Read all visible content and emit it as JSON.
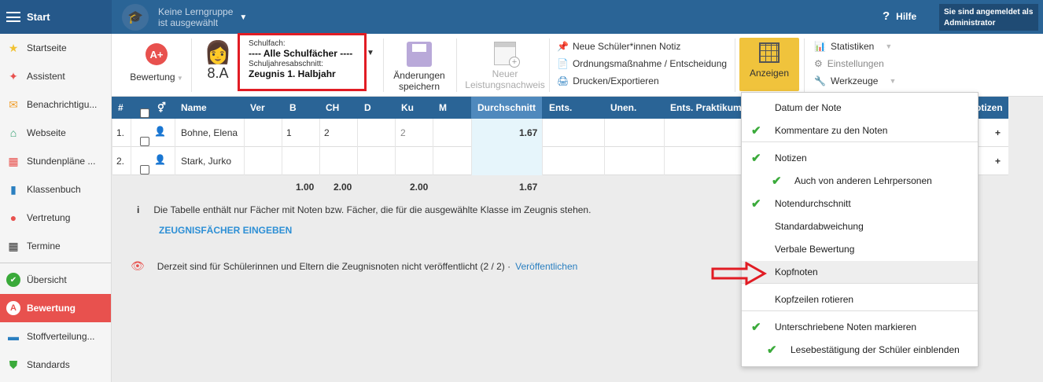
{
  "topbar": {
    "start_label": "Start",
    "group_line1": "Keine Lerngruppe",
    "group_line2": "ist ausgewählt",
    "help_label": "Hilfe",
    "login_line1": "Sie sind angemeldet als",
    "login_line2": "Administrator"
  },
  "sidebar": {
    "items": [
      {
        "label": "Startseite",
        "icon": "star-icon",
        "color": "#f1c232"
      },
      {
        "label": "Assistent",
        "icon": "wand-icon",
        "color": "#e8514e"
      },
      {
        "label": "Benachrichtigu...",
        "icon": "envelope-icon",
        "color": "#f0a030"
      },
      {
        "label": "Webseite",
        "icon": "home-icon",
        "color": "#2e9e6e"
      },
      {
        "label": "Stundenpläne ...",
        "icon": "calendar-icon",
        "color": "#e8514e"
      },
      {
        "label": "Klassenbuch",
        "icon": "book-icon",
        "color": "#2a7fc0"
      },
      {
        "label": "Vertretung",
        "icon": "person-icon",
        "color": "#e8514e"
      },
      {
        "label": "Termine",
        "icon": "calendar-icon",
        "color": "#333333"
      },
      {
        "label": "Übersicht",
        "icon": "check-circle-icon",
        "color": "#3aaa3a"
      },
      {
        "label": "Bewertung",
        "icon": "grade-icon",
        "color": "#ffffff"
      },
      {
        "label": "Stoffverteilung...",
        "icon": "briefcase-icon",
        "color": "#2a7fc0"
      },
      {
        "label": "Standards",
        "icon": "shield-icon",
        "color": "#3aaa3a"
      }
    ]
  },
  "toolbar": {
    "bewertung_label": "Bewertung",
    "bewertung_icon_text": "A+",
    "class_label": "8.A",
    "subject_caption": "Schulfach:",
    "subject_value": "---- Alle Schulfächer ----",
    "period_caption": "Schuljahresabschnitt:",
    "period_value": "Zeugnis 1. Halbjahr",
    "save_line1": "Änderungen",
    "save_line2": "speichern",
    "new_line1": "Neuer",
    "new_line2": "Leistungsnachweis",
    "links": [
      "Neue Schüler*innen Notiz",
      "Ordnungsmaßnahme / Entscheidung",
      "Drucken/Exportieren"
    ],
    "anzeigen_label": "Anzeigen",
    "right_links": [
      "Statistiken",
      "Einstellungen",
      "Werkzeuge"
    ]
  },
  "table": {
    "headers": [
      "#",
      "Name",
      "Ver",
      "B",
      "CH",
      "D",
      "Ku",
      "M",
      "Durchschnitt",
      "Ents.",
      "Unen.",
      "Ents. Praktikum",
      "otizen"
    ],
    "rows": [
      {
        "num": "1.",
        "name": "Bohne, Elena",
        "B": "1",
        "CH": "2",
        "Ku": "2",
        "avg": "1.67"
      },
      {
        "num": "2.",
        "name": "Stark, Jurko",
        "B": "",
        "CH": "",
        "Ku": "",
        "avg": ""
      }
    ],
    "sums": {
      "B": "1.00",
      "CH": "2.00",
      "Ku": "2.00",
      "avg": "1.67"
    }
  },
  "info": {
    "text": "Die Tabelle enthält nur Fächer mit Noten bzw. Fächer, die für die ausgewählte Klasse im Zeugnis stehen.",
    "link": "ZEUGNISFÄCHER EINGEBEN",
    "publish_text": "Derzeit sind für Schülerinnen und Eltern die Zeugnisnoten nicht veröffentlicht (2 / 2) ·",
    "publish_link": "Veröffentlichen"
  },
  "menu": {
    "items": [
      {
        "label": "Datum der Note",
        "checked": false,
        "indent": false
      },
      {
        "label": "Kommentare zu den Noten",
        "checked": true,
        "indent": false
      },
      {
        "label": "Notizen",
        "checked": true,
        "indent": false
      },
      {
        "label": "Auch von anderen Lehrpersonen",
        "checked": true,
        "indent": true
      },
      {
        "label": "Notendurchschnitt",
        "checked": true,
        "indent": false
      },
      {
        "label": "Standardabweichung",
        "checked": false,
        "indent": false
      },
      {
        "label": "Verbale Bewertung",
        "checked": false,
        "indent": false
      },
      {
        "label": "Kopfnoten",
        "checked": false,
        "indent": false
      },
      {
        "label": "Kopfzeilen rotieren",
        "checked": false,
        "indent": false
      },
      {
        "label": "Unterschriebene Noten markieren",
        "checked": true,
        "indent": false
      },
      {
        "label": "Lesebestätigung der Schüler einblenden",
        "checked": true,
        "indent": true
      }
    ]
  },
  "colors": {
    "accent": "#2a6496",
    "active": "#e8514e",
    "highlight": "#e11c24",
    "anzeigen": "#f0c33c"
  }
}
